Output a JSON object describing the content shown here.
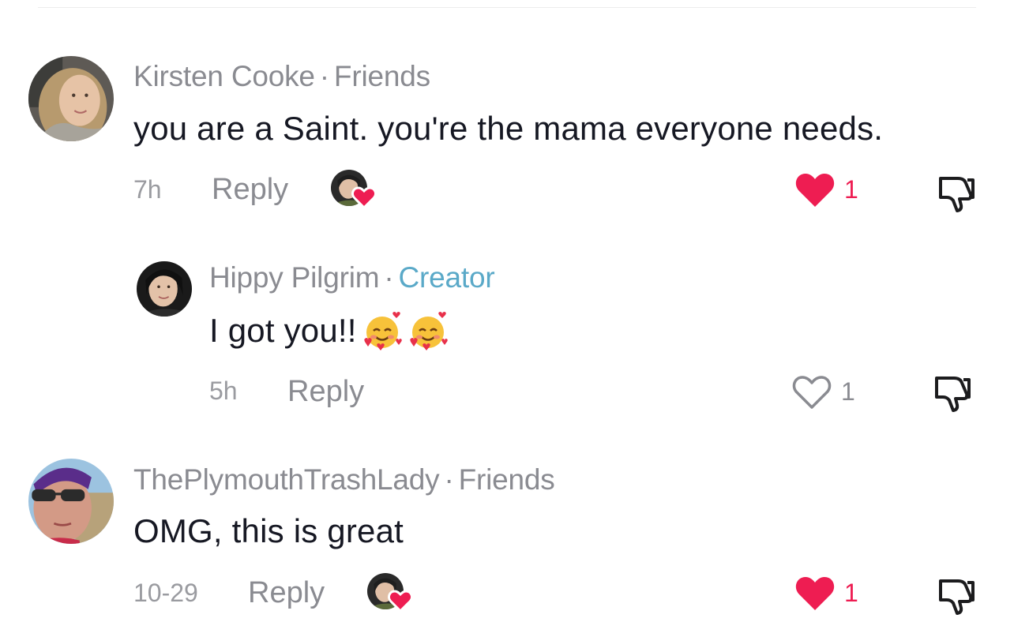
{
  "comments": [
    {
      "author": "Kirsten Cooke",
      "relation": "Friends",
      "text": "you are a Saint. you're the mama everyone needs.",
      "time": "7h",
      "reply_label": "Reply",
      "liked_by_creator": true,
      "likes": "1",
      "liked": true
    },
    {
      "author": "Hippy Pilgrim",
      "relation": "Creator",
      "text": "I got you!!",
      "emoji": [
        "smiling-face-with-hearts",
        "smiling-face-with-hearts"
      ],
      "time": "5h",
      "reply_label": "Reply",
      "liked_by_creator": false,
      "likes": "1",
      "liked": false
    },
    {
      "author": "ThePlymouthTrashLady",
      "relation": "Friends",
      "text": "OMG, this is great",
      "time": "10-29",
      "reply_label": "Reply",
      "liked_by_creator": true,
      "likes": "1",
      "liked": true
    }
  ],
  "separator": "·",
  "colors": {
    "like_red": "#ee1d52",
    "creator_blue": "#5aa9c8",
    "meta_gray": "#8a8b91",
    "text_dark": "#161823"
  }
}
